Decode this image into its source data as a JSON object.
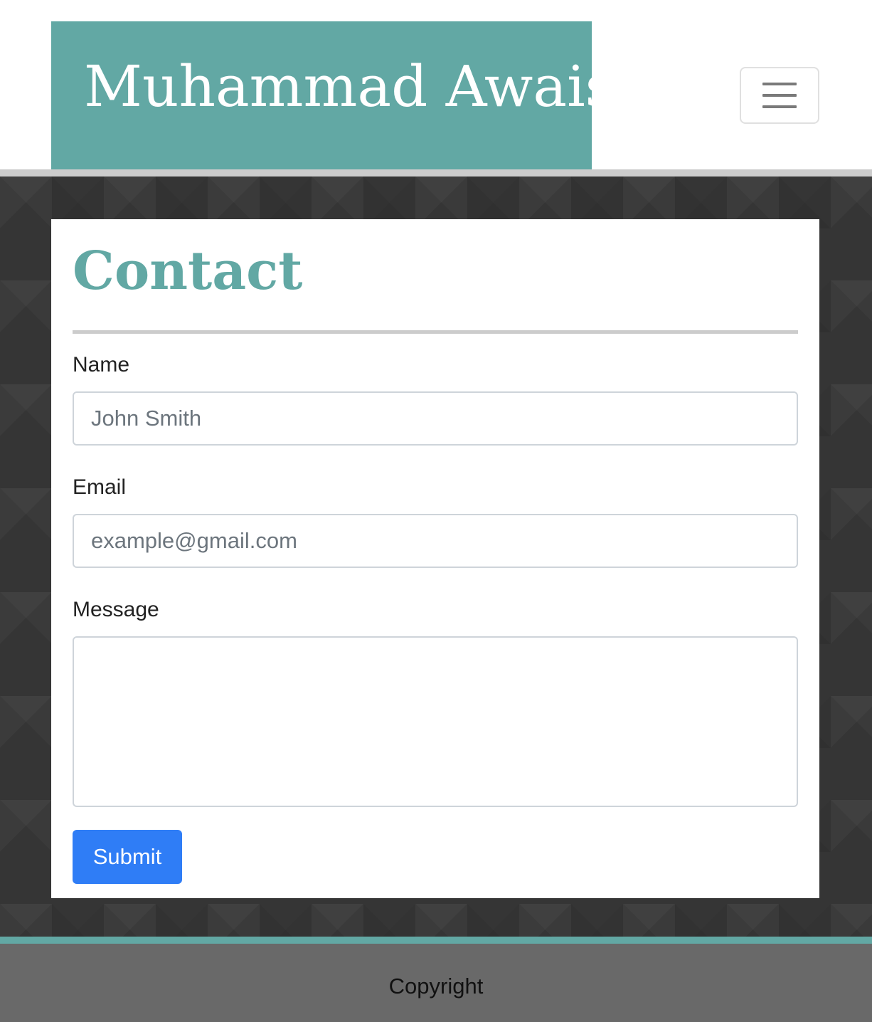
{
  "header": {
    "brand": "Muhammad Awais",
    "menu_icon": "hamburger-menu-icon"
  },
  "contact": {
    "title": "Contact",
    "name_label": "Name",
    "name_placeholder": "John Smith",
    "email_label": "Email",
    "email_placeholder": "example@gmail.com",
    "message_label": "Message",
    "message_value": "",
    "submit_label": "Submit"
  },
  "footer": {
    "text": "Copyright"
  },
  "colors": {
    "accent": "#62a8a4",
    "primary_button": "#2f7df6",
    "background_dark": "#353535",
    "footer_bg": "#696969"
  }
}
